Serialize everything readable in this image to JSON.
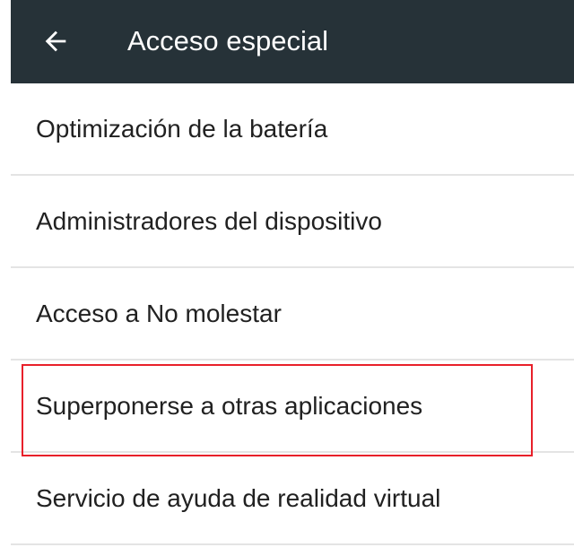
{
  "header": {
    "title": "Acceso especial",
    "back_icon": "arrow-left-icon",
    "background_color": "#263238"
  },
  "list": {
    "items": [
      {
        "label": "Optimización de la batería"
      },
      {
        "label": "Administradores del dispositivo"
      },
      {
        "label": "Acceso a No molestar"
      },
      {
        "label": "Superponerse a otras aplicaciones",
        "highlighted": true
      },
      {
        "label": "Servicio de ayuda de realidad virtual"
      }
    ]
  },
  "highlight_color": "#e8202a"
}
